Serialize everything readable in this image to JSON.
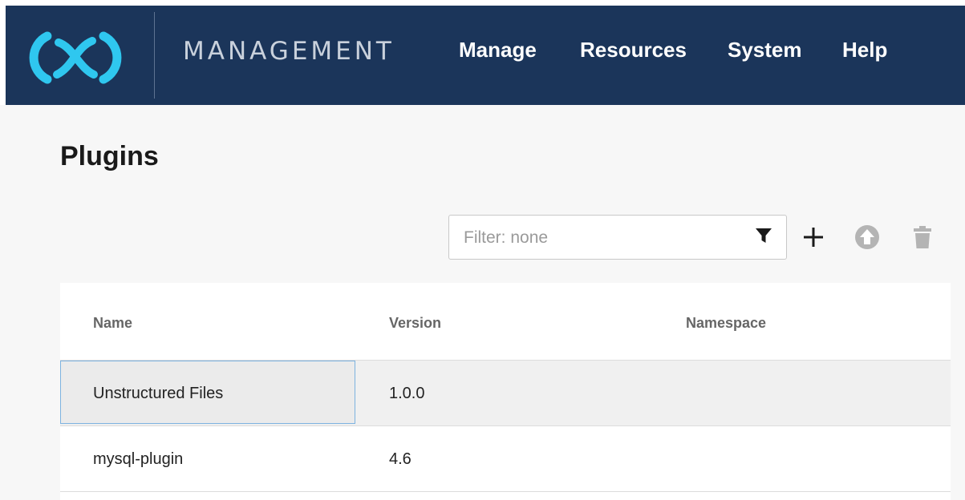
{
  "header": {
    "app_title": "MANAGEMENT",
    "nav": [
      {
        "label": "Manage"
      },
      {
        "label": "Resources"
      },
      {
        "label": "System"
      },
      {
        "label": "Help"
      }
    ],
    "colors": {
      "background": "#1b355a",
      "logo": "#2fc7ef"
    }
  },
  "page": {
    "title": "Plugins"
  },
  "toolbar": {
    "filter_placeholder": "Filter: none",
    "filter_icon": "funnel-icon",
    "add_icon": "plus-icon",
    "upload_icon": "upload-arrow-icon",
    "delete_icon": "trash-icon"
  },
  "table": {
    "columns": [
      "Name",
      "Version",
      "Namespace"
    ],
    "rows": [
      {
        "name": "Unstructured Files",
        "version": "1.0.0",
        "namespace": "",
        "selected": true
      },
      {
        "name": "mysql-plugin",
        "version": "4.6",
        "namespace": "",
        "selected": false
      }
    ]
  }
}
